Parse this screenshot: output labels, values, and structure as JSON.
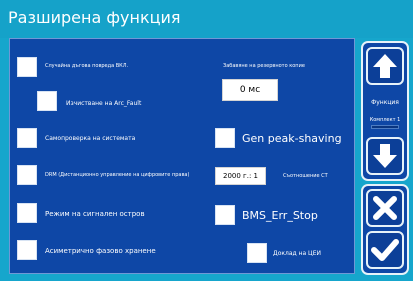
{
  "window": {
    "title": "Разширена функция"
  },
  "options": {
    "arc_fault_on": "Случайна дъгова повреда ВКЛ.",
    "clear_arc_fault": "Изчистване на Arc_Fault",
    "self_check": "Самопроверка на системата",
    "drm": "DRM (Дистанционно управление на цифровите правa)",
    "island_signal": "Режим на сигнален остров",
    "asym_feed": "Асиметрично фазово хранене",
    "gen_peak": "Gen peak-shaving",
    "bms_err": "BMS_Err_Stop",
    "ceu_report": "Доклад на ЦЕИ"
  },
  "settings": {
    "delay_label": "Забавяне на резервното копие",
    "delay_value": "0 мс",
    "year_value": "2000 г.: 1",
    "ct_label": "Съотношение CT"
  },
  "sidebar": {
    "function_label": "Функция",
    "set_label": "Комплект 1"
  },
  "colors": {
    "background": "#16a6cc",
    "panel": "#0e47a6",
    "button_border": "#e6f2f9"
  },
  "icons": {
    "up": "arrow-up-icon",
    "down": "arrow-down-icon",
    "cancel": "cross-icon",
    "confirm": "checkmark-icon"
  }
}
